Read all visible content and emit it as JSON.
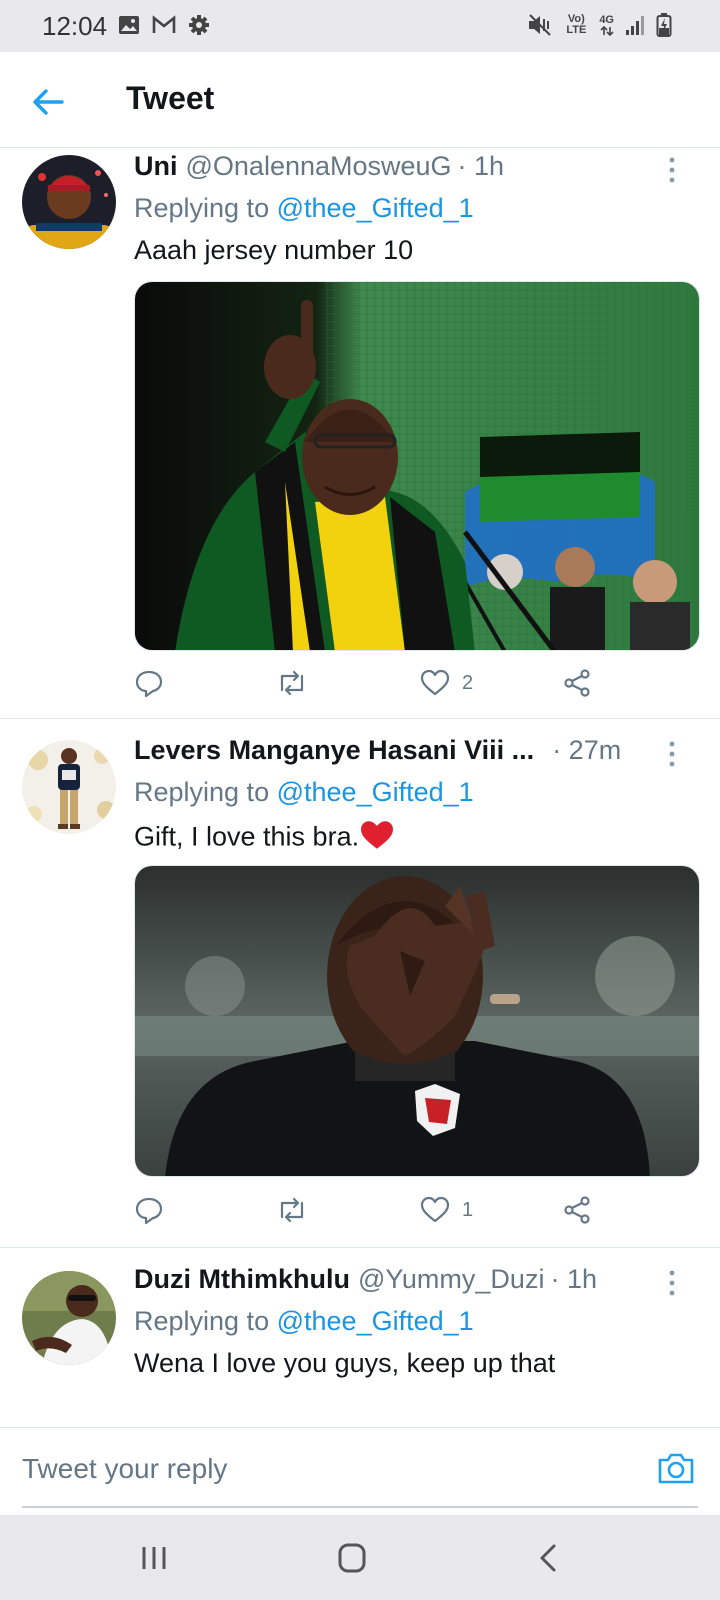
{
  "status_bar": {
    "time": "12:04",
    "left_icons": [
      "image-icon",
      "gmail-icon",
      "settings-gear-icon"
    ],
    "volte_label": "Vo) LTE",
    "network_label": "4G",
    "right_icons": [
      "mute-vibrate-icon",
      "volte-icon",
      "network-4g-icon",
      "signal-icon",
      "battery-charging-icon"
    ]
  },
  "header": {
    "back_icon": "back-arrow-icon",
    "title": "Tweet"
  },
  "colors": {
    "accent": "#1b95e0",
    "text": "#14171a",
    "secondary": "#657786",
    "divider": "#e1e8ed",
    "heart": "#e0245e"
  },
  "tweets": [
    {
      "name": "Uni",
      "handle": "@OnalennaMosweuG",
      "time": "· 1h",
      "replying_prefix": "Replying to",
      "replying_to": "@thee_Gifted_1",
      "text": "Aaah jersey number 10",
      "media_icon": "photo-man-raising-finger",
      "likes": "2"
    },
    {
      "name": "Levers Manganye Hasani Viii ...",
      "handle": "",
      "time": "· 27m",
      "replying_prefix": "Replying to",
      "replying_to": "@thee_Gifted_1",
      "text": "Gift, I love this bra.",
      "emoji": "❤️",
      "media_icon": "photo-man-heart-hands",
      "likes": "1"
    },
    {
      "name": "Duzi Mthimkhulu",
      "handle": "@Yummy_Duzi",
      "time": "· 1h",
      "replying_prefix": "Replying to",
      "replying_to": "@thee_Gifted_1",
      "text": "Wena I love you guys, keep up that"
    }
  ],
  "actions": {
    "reply_icon": "reply-icon",
    "retweet_icon": "retweet-icon",
    "like_icon": "heart-icon",
    "share_icon": "share-icon"
  },
  "reply_bar": {
    "placeholder": "Tweet your reply",
    "camera_icon": "camera-icon"
  },
  "nav_bar": {
    "icons": [
      "recent-apps-icon",
      "home-icon",
      "back-icon"
    ]
  }
}
